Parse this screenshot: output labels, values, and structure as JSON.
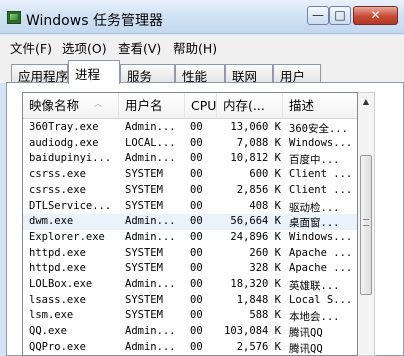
{
  "window": {
    "title": "Windows 任务管理器",
    "minimize_glyph": "—",
    "maximize_glyph": "□",
    "close_glyph": "✕"
  },
  "menu": {
    "items": [
      {
        "label": "文件(F)"
      },
      {
        "label": "选项(O)"
      },
      {
        "label": "查看(V)"
      },
      {
        "label": "帮助(H)"
      }
    ]
  },
  "tabs": {
    "items": [
      {
        "label": "应用程序"
      },
      {
        "label": "进程"
      },
      {
        "label": "服务"
      },
      {
        "label": "性能"
      },
      {
        "label": "联网"
      },
      {
        "label": "用户"
      }
    ],
    "active": "进程"
  },
  "process_table": {
    "sort_icon": "︿",
    "columns": [
      {
        "label": "映像名称"
      },
      {
        "label": "用户名"
      },
      {
        "label": "CPU"
      },
      {
        "label": "内存(..."
      },
      {
        "label": "描述"
      }
    ],
    "rows": [
      {
        "name": "360Tray.exe",
        "user": "Admin...",
        "cpu": "00",
        "mem": "13,060 K",
        "desc": "360安全..."
      },
      {
        "name": "audiodg.exe",
        "user": "LOCAL...",
        "cpu": "00",
        "mem": "7,088 K",
        "desc": "Windows..."
      },
      {
        "name": "baidupinyi...",
        "user": "Admin...",
        "cpu": "00",
        "mem": "10,812 K",
        "desc": "百度中..."
      },
      {
        "name": "csrss.exe",
        "user": "SYSTEM",
        "cpu": "00",
        "mem": "600 K",
        "desc": "Client ..."
      },
      {
        "name": "csrss.exe",
        "user": "SYSTEM",
        "cpu": "00",
        "mem": "2,856 K",
        "desc": "Client ..."
      },
      {
        "name": "DTLService...",
        "user": "SYSTEM",
        "cpu": "00",
        "mem": "408 K",
        "desc": "驱动检..."
      },
      {
        "name": "dwm.exe",
        "user": "Admin...",
        "cpu": "00",
        "mem": "56,664 K",
        "desc": "桌面窗..."
      },
      {
        "name": "Explorer.exe",
        "user": "Admin...",
        "cpu": "00",
        "mem": "24,896 K",
        "desc": "Windows..."
      },
      {
        "name": "httpd.exe",
        "user": "SYSTEM",
        "cpu": "00",
        "mem": "260 K",
        "desc": "Apache ..."
      },
      {
        "name": "httpd.exe",
        "user": "SYSTEM",
        "cpu": "00",
        "mem": "328 K",
        "desc": "Apache ..."
      },
      {
        "name": "LOLBox.exe",
        "user": "Admin...",
        "cpu": "00",
        "mem": "18,320 K",
        "desc": "英雄联..."
      },
      {
        "name": "lsass.exe",
        "user": "SYSTEM",
        "cpu": "00",
        "mem": "1,848 K",
        "desc": "Local S..."
      },
      {
        "name": "lsm.exe",
        "user": "SYSTEM",
        "cpu": "00",
        "mem": "588 K",
        "desc": "本地会..."
      },
      {
        "name": "QQ.exe",
        "user": "Admin...",
        "cpu": "00",
        "mem": "103,084 K",
        "desc": "腾讯QQ"
      },
      {
        "name": "QQPro.exe",
        "user": "Admin...",
        "cpu": "00",
        "mem": "2,576 K",
        "desc": "腾讯QQ"
      }
    ],
    "selected_row": "dwm.exe"
  },
  "scrollbar": {
    "up_glyph": "▲"
  }
}
